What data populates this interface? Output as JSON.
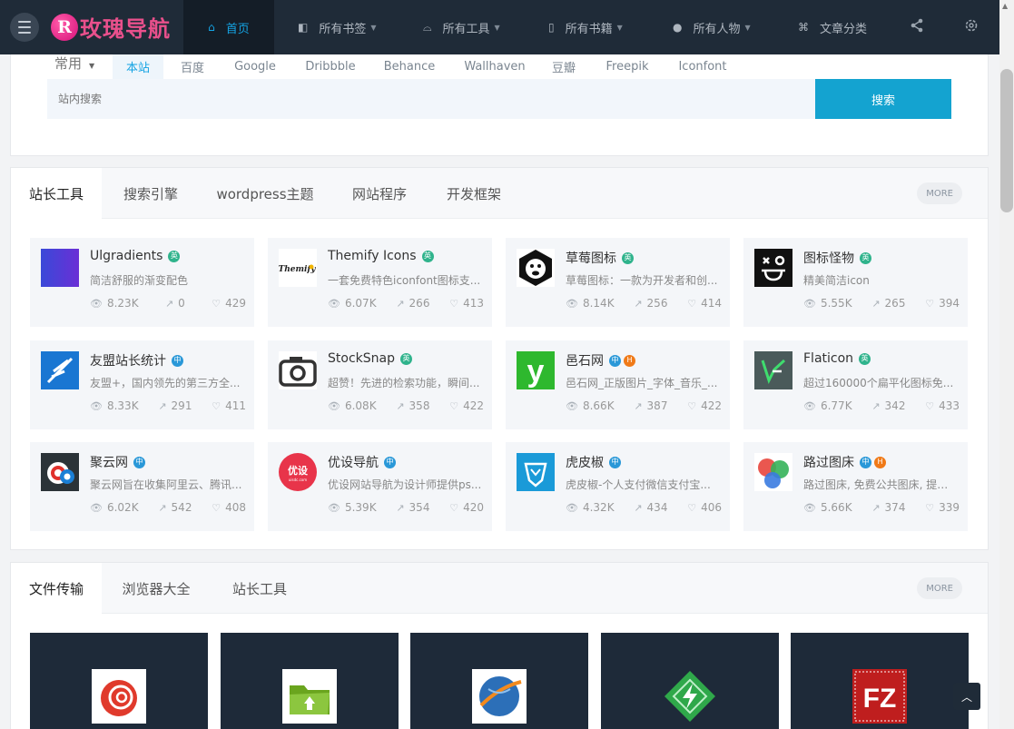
{
  "brand": {
    "name": "玫瑰导航",
    "mark": "R"
  },
  "nav": {
    "home": "首页",
    "bookmarks": "所有书签",
    "tools": "所有工具",
    "books": "所有书籍",
    "people": "所有人物",
    "articles": "文章分类"
  },
  "search": {
    "group": "常用",
    "tabs": [
      "本站",
      "百度",
      "Google",
      "Dribbble",
      "Behance",
      "Wallhaven",
      "豆瓣",
      "Freepik",
      "Iconfont"
    ],
    "placeholder": "站内搜索",
    "button": "搜索"
  },
  "section1": {
    "tabs": [
      "站长工具",
      "搜索引擎",
      "wordpress主题",
      "网站程序",
      "开发框架"
    ],
    "more": "MORE",
    "cards": [
      {
        "title": "Ulgradients",
        "badges": [
          "英"
        ],
        "desc": "简洁舒服的渐变配色",
        "views": "8.23K",
        "clicks": "0",
        "likes": "429"
      },
      {
        "title": "Themify Icons",
        "badges": [
          "英"
        ],
        "desc": "一套免费特色iconfont图标支...",
        "views": "6.07K",
        "clicks": "266",
        "likes": "413"
      },
      {
        "title": "草莓图标",
        "badges": [
          "英"
        ],
        "desc": "草莓图标：一款为开发者和创...",
        "views": "8.14K",
        "clicks": "256",
        "likes": "414"
      },
      {
        "title": "图标怪物",
        "badges": [
          "英"
        ],
        "desc": "精美简洁icon",
        "views": "5.55K",
        "clicks": "265",
        "likes": "394"
      },
      {
        "title": "友盟站长统计",
        "badges": [
          "中"
        ],
        "desc": "友盟+，国内领先的第三方全...",
        "views": "8.33K",
        "clicks": "291",
        "likes": "411"
      },
      {
        "title": "StockSnap",
        "badges": [
          "英"
        ],
        "desc": "超赞！先进的检索功能，瞬间...",
        "views": "6.08K",
        "clicks": "358",
        "likes": "422"
      },
      {
        "title": "邑石网",
        "badges": [
          "中",
          "H"
        ],
        "desc": "邑石网_正版图片_字体_音乐_...",
        "views": "8.66K",
        "clicks": "387",
        "likes": "422"
      },
      {
        "title": "Flaticon",
        "badges": [
          "英"
        ],
        "desc": "超过160000个扁平化图标免...",
        "views": "6.77K",
        "clicks": "342",
        "likes": "433"
      },
      {
        "title": "聚云网",
        "badges": [
          "中"
        ],
        "desc": "聚云网旨在收集阿里云、腾讯...",
        "views": "6.02K",
        "clicks": "542",
        "likes": "408"
      },
      {
        "title": "优设导航",
        "badges": [
          "中"
        ],
        "desc": "优设网站导航为设计师提供ps...",
        "views": "5.39K",
        "clicks": "354",
        "likes": "420"
      },
      {
        "title": "虎皮椒",
        "badges": [
          "中"
        ],
        "desc": "虎皮椒-个人支付微信支付宝...",
        "views": "4.32K",
        "clicks": "434",
        "likes": "406"
      },
      {
        "title": "路过图床",
        "badges": [
          "中",
          "H"
        ],
        "desc": "路过图床, 免费公共图床, 提供...",
        "views": "5.66K",
        "clicks": "374",
        "likes": "339"
      }
    ]
  },
  "section2": {
    "tabs": [
      "文件传输",
      "浏览器大全",
      "站长工具"
    ],
    "more": "MORE"
  }
}
